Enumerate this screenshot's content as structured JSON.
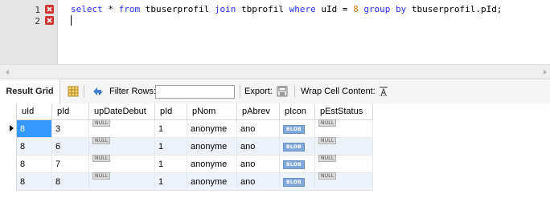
{
  "editor": {
    "line_numbers": [
      "1",
      "2"
    ],
    "query_tokens": [
      {
        "text": "select",
        "kind": "kw"
      },
      {
        "text": " * ",
        "kind": "plain"
      },
      {
        "text": "from",
        "kind": "kw"
      },
      {
        "text": " tbuserprofil ",
        "kind": "plain"
      },
      {
        "text": "join",
        "kind": "kw"
      },
      {
        "text": " tbprofil ",
        "kind": "plain"
      },
      {
        "text": "where",
        "kind": "kw"
      },
      {
        "text": " uId = ",
        "kind": "plain"
      },
      {
        "text": "8",
        "kind": "num"
      },
      {
        "text": " ",
        "kind": "plain"
      },
      {
        "text": "group",
        "kind": "kw"
      },
      {
        "text": " ",
        "kind": "plain"
      },
      {
        "text": "by",
        "kind": "kw"
      },
      {
        "text": " tbuserprofil.pId;",
        "kind": "plain"
      }
    ],
    "icons": [
      "error-marker-icon",
      "error-marker-icon"
    ]
  },
  "toolbar": {
    "result_grid_label": "Result Grid",
    "filter_rows_label": "Filter Rows:",
    "filter_value": "",
    "export_label": "Export:",
    "wrap_label": "Wrap Cell Content:",
    "icons": [
      "grid-view-icon",
      "refresh-icon",
      "export-icon",
      "wrap-cell-icon"
    ]
  },
  "grid": {
    "columns": [
      "uId",
      "pId",
      "upDateDebut",
      "pId",
      "pNom",
      "pAbrev",
      "pIcon",
      "pEstStatus"
    ],
    "rows": [
      [
        "8",
        "3",
        "NULL",
        "1",
        "anonyme",
        "ano",
        "BLOB",
        "NULL"
      ],
      [
        "8",
        "6",
        "NULL",
        "1",
        "anonyme",
        "ano",
        "BLOB",
        "NULL"
      ],
      [
        "8",
        "7",
        "NULL",
        "1",
        "anonyme",
        "ano",
        "BLOB",
        "NULL"
      ],
      [
        "8",
        "8",
        "NULL",
        "1",
        "anonyme",
        "ano",
        "BLOB",
        "NULL"
      ]
    ],
    "selected_row": 0,
    "selected_col": 0,
    "colors": {
      "selection": "#3399ff",
      "alt_row": "#eef3fb",
      "blob_badge": "#7fa7d9",
      "keyword": "#2030ff",
      "number": "#e07000"
    }
  }
}
